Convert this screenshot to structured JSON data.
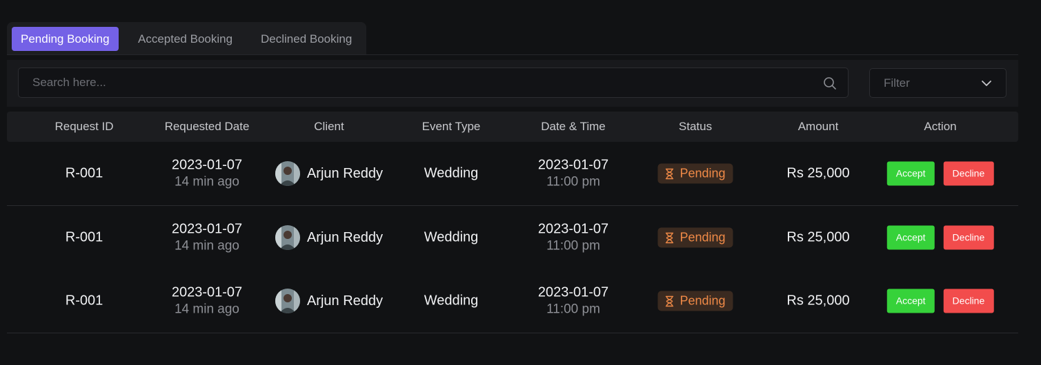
{
  "tabs": [
    {
      "label": "Pending Booking",
      "active": true
    },
    {
      "label": "Accepted Booking",
      "active": false
    },
    {
      "label": "Declined Booking",
      "active": false
    }
  ],
  "search": {
    "placeholder": "Search here..."
  },
  "filter": {
    "label": "Filter"
  },
  "table": {
    "columns": [
      "Request ID",
      "Requested Date",
      "Client",
      "Event Type",
      "Date & Time",
      "Status",
      "Amount",
      "Action"
    ],
    "rows": [
      {
        "request_id": "R-001",
        "requested_date": "2023-01-07",
        "requested_ago": "14 min ago",
        "client": "Arjun Reddy",
        "event_type": "Wedding",
        "date": "2023-01-07",
        "time": "11:00 pm",
        "status": "Pending",
        "amount": "Rs 25,000",
        "accept_label": "Accept",
        "decline_label": "Decline"
      },
      {
        "request_id": "R-001",
        "requested_date": "2023-01-07",
        "requested_ago": "14 min ago",
        "client": "Arjun Reddy",
        "event_type": "Wedding",
        "date": "2023-01-07",
        "time": "11:00 pm",
        "status": "Pending",
        "amount": "Rs 25,000",
        "accept_label": "Accept",
        "decline_label": "Decline"
      },
      {
        "request_id": "R-001",
        "requested_date": "2023-01-07",
        "requested_ago": "14 min ago",
        "client": "Arjun Reddy",
        "event_type": "Wedding",
        "date": "2023-01-07",
        "time": "11:00 pm",
        "status": "Pending",
        "amount": "Rs 25,000",
        "accept_label": "Accept",
        "decline_label": "Decline"
      }
    ]
  },
  "colors": {
    "accent": "#7461e6",
    "accept": "#36d23a",
    "decline": "#f24c4c",
    "pending": "#f08a47"
  },
  "icons": {
    "search": "search-icon",
    "filter": "chevron-down-icon",
    "status": "hourglass-icon",
    "avatar": "avatar"
  }
}
